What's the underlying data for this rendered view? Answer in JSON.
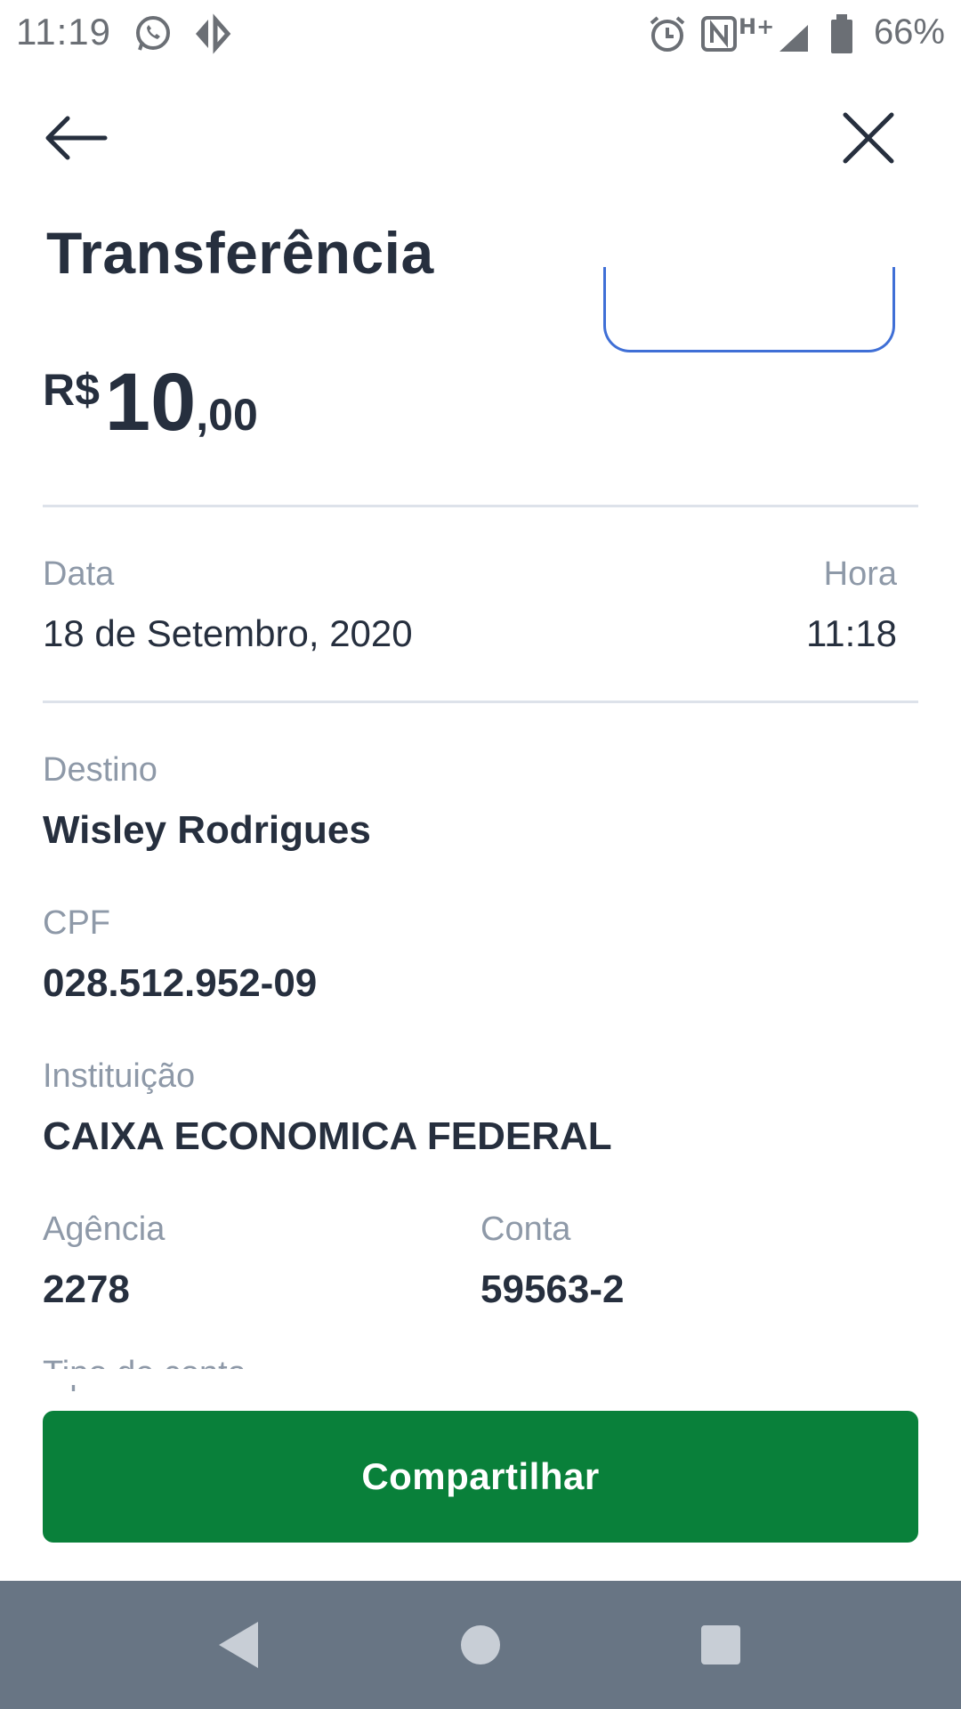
{
  "status_bar": {
    "time": "11:19",
    "battery_percent": "66%",
    "icons": [
      "whatsapp-icon",
      "app-icon",
      "alarm-icon",
      "nfc-icon",
      "signal-hplus-icon",
      "battery-icon"
    ]
  },
  "header": {
    "title": "Transferência",
    "back_icon": "arrow-left-icon",
    "close_icon": "close-icon"
  },
  "amount": {
    "currency": "R$",
    "integer": "10",
    "decimal": ",00"
  },
  "details": {
    "date_label": "Data",
    "date_value": "18 de Setembro, 2020",
    "time_label": "Hora",
    "time_value": "11:18",
    "destination_label": "Destino",
    "destination_value": "Wisley Rodrigues",
    "cpf_label": "CPF",
    "cpf_value": "028.512.952-09",
    "institution_label": "Instituição",
    "institution_value": "CAIXA ECONOMICA FEDERAL",
    "agency_label": "Agência",
    "agency_value": "2278",
    "account_label": "Conta",
    "account_value": "59563-2",
    "cut_label": "Tipo de conta"
  },
  "actions": {
    "share_label": "Compartilhar"
  },
  "colors": {
    "primary_text": "#262f3e",
    "label_text": "#8e99a8",
    "share_button": "#09803a",
    "outline_blue": "#3f6fd6",
    "nav_bar": "#687584"
  }
}
